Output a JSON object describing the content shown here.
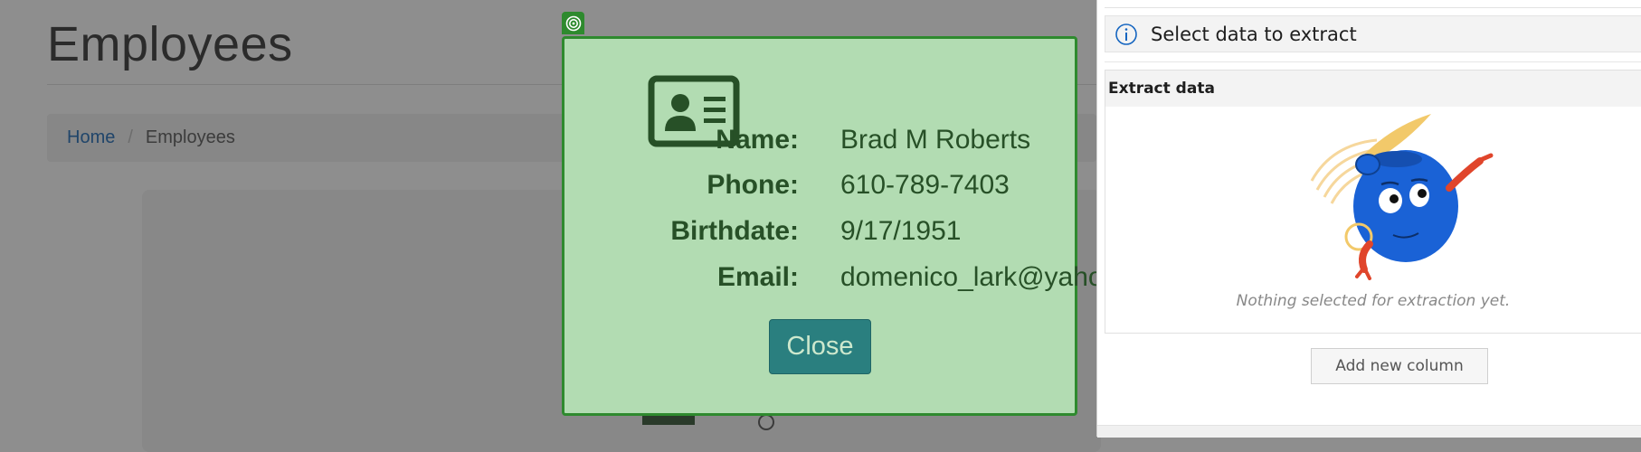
{
  "page": {
    "title": "Employees",
    "breadcrumb": {
      "home": "Home",
      "separator": "/",
      "current": "Employees"
    }
  },
  "modal": {
    "icon": "id-card-icon",
    "fields": [
      {
        "label": "Name:",
        "value": "Brad M Roberts"
      },
      {
        "label": "Phone:",
        "value": "610-789-7403"
      },
      {
        "label": "Birthdate:",
        "value": "9/17/1951"
      },
      {
        "label": "Email:",
        "value": "domenico_lark@yaho"
      }
    ],
    "close_label": "Close",
    "target_icon": "target-icon"
  },
  "panel": {
    "info_text": "Select data to extract",
    "info_icon": "info-icon",
    "section_title": "Extract data",
    "empty_text": "Nothing selected for extraction yet.",
    "mascot_icon": "robot-mascot-icon",
    "add_column_label": "Add new column"
  },
  "colors": {
    "modal_bg": "#b2dcb2",
    "modal_border": "#2e8a2e",
    "close_button": "#2a7f7f",
    "link": "#20456a",
    "accent_blue": "#1565c0"
  }
}
